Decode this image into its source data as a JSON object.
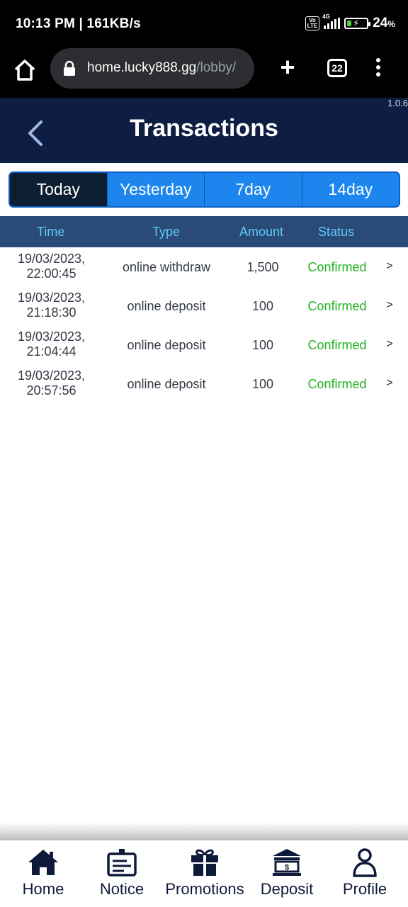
{
  "status_bar": {
    "time_speed": "10:13 PM | 161KB/s",
    "volte": "Vo LTE",
    "network": "4G",
    "battery_percent": "24",
    "battery_suffix": "%",
    "battery_level": 0.24
  },
  "browser": {
    "url_host": "home.lucky888.gg",
    "url_path": "/lobby/",
    "tab_count": "22",
    "plus_symbol": "+"
  },
  "header": {
    "title": "Transactions",
    "version": "1.0.6"
  },
  "tabs": [
    "Today",
    "Yesterday",
    "7day",
    "14day"
  ],
  "active_tab": "Today",
  "table": {
    "columns": [
      "Time",
      "Type",
      "Amount",
      "Status"
    ],
    "rows": [
      {
        "date": "19/03/2023,",
        "time": "22:00:45",
        "type": "online withdraw",
        "amount": "1,500",
        "status": "Confirmed",
        "arrow": ">"
      },
      {
        "date": "19/03/2023,",
        "time": "21:18:30",
        "type": "online deposit",
        "amount": "100",
        "status": "Confirmed",
        "arrow": ">"
      },
      {
        "date": "19/03/2023,",
        "time": "21:04:44",
        "type": "online deposit",
        "amount": "100",
        "status": "Confirmed",
        "arrow": ">"
      },
      {
        "date": "19/03/2023,",
        "time": "20:57:56",
        "type": "online deposit",
        "amount": "100",
        "status": "Confirmed",
        "arrow": ">"
      }
    ]
  },
  "bottom_nav": [
    {
      "label": "Home",
      "icon": "home-icon"
    },
    {
      "label": "Notice",
      "icon": "notice-icon"
    },
    {
      "label": "Promotions",
      "icon": "gift-icon"
    },
    {
      "label": "Deposit",
      "icon": "bank-icon"
    },
    {
      "label": "Profile",
      "icon": "user-icon"
    }
  ],
  "colors": {
    "header_bg": "#0e1e42",
    "tab_active": "#0e1e32",
    "tab_bg": "#1c86ee",
    "table_head_bg": "#2a4a78",
    "table_head_text": "#5ecbf3",
    "status_confirmed": "#22b322",
    "nav_icon": "#0e1a3a"
  }
}
